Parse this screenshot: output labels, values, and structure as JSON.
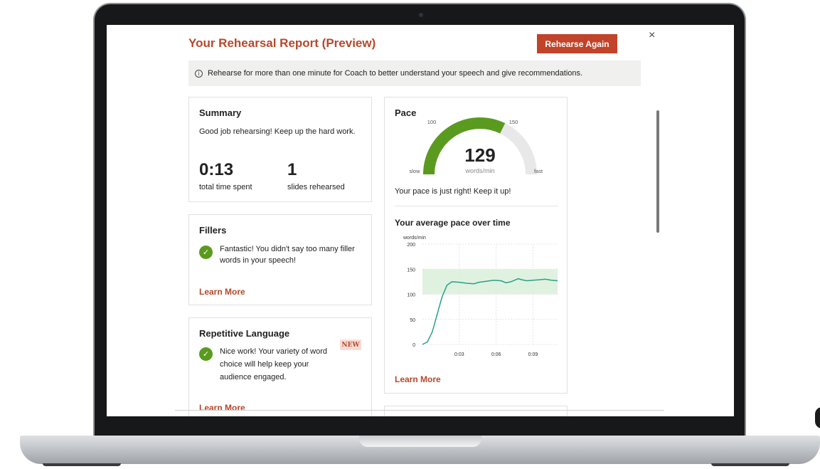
{
  "header": {
    "title": "Your Rehearsal Report (Preview)",
    "rehearse_again_label": "Rehearse Again",
    "close_glyph": "×"
  },
  "banner": {
    "info_glyph": "i",
    "text": "Rehearse for more than one minute for Coach to better understand your speech and give recommendations."
  },
  "summary": {
    "title": "Summary",
    "message": "Good job rehearsing! Keep up the hard work.",
    "time_value": "0:13",
    "time_label": "total time spent",
    "slides_value": "1",
    "slides_label": "slides rehearsed"
  },
  "fillers": {
    "title": "Fillers",
    "message": "Fantastic! You didn't say too many filler words in your speech!",
    "learn_more": "Learn More"
  },
  "repetitive": {
    "title": "Repetitive Language",
    "badge": "NEW",
    "message": "Nice work! Your variety of word choice will help keep your audience engaged.",
    "learn_more": "Learn More"
  },
  "pace": {
    "title": "Pace",
    "gauge": {
      "value": "129",
      "unit": "words/min",
      "label_slow": "slow",
      "label_fast": "fast",
      "tick_100": "100",
      "tick_150": "150"
    },
    "message": "Your pace is just right! Keep it up!",
    "over_time_title": "Your average pace over time",
    "learn_more": "Learn More"
  },
  "colors": {
    "accent": "#c0432a",
    "good_green": "#5a9a1e",
    "gauge_track": "#e8e8e8",
    "line": "#2aa088",
    "band": "#dff2e0"
  },
  "chart_data": {
    "type": "line",
    "ylabel": "words/min",
    "yticks": [
      "200",
      "150",
      "100",
      "50",
      "0"
    ],
    "xticks": [
      "0:03",
      "0:06",
      "0:09"
    ],
    "ylim": [
      0,
      200
    ],
    "xlim": [
      0,
      11
    ],
    "target_band": [
      100,
      150
    ],
    "series": [
      {
        "x": [
          0,
          0.4,
          0.8,
          1.2,
          1.6,
          2.0,
          2.4,
          3.0,
          3.6,
          4.2,
          4.6,
          5.2,
          5.8,
          6.4,
          6.8,
          7.2,
          7.8,
          8.1,
          8.5,
          9.0,
          9.5,
          10.0,
          10.5,
          11.0
        ],
        "y": [
          0,
          5,
          25,
          60,
          95,
          118,
          125,
          124,
          122,
          121,
          124,
          126,
          128,
          127,
          123,
          125,
          131,
          129,
          127,
          128,
          129,
          130,
          128,
          127
        ]
      }
    ]
  }
}
